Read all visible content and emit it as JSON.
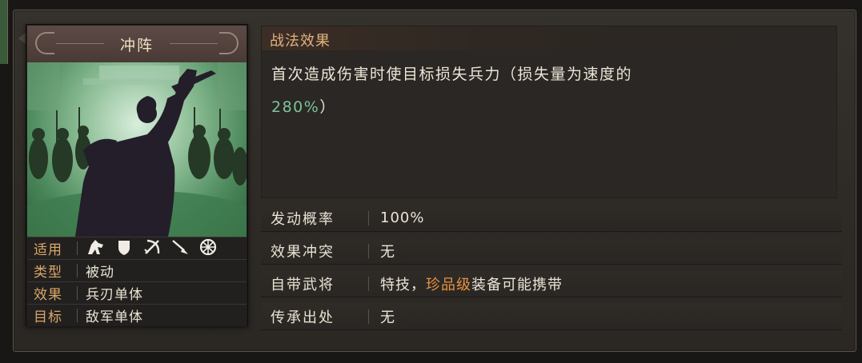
{
  "skill": {
    "name": "冲阵",
    "attributes": {
      "applicable": {
        "label": "适用",
        "icons": [
          "cavalry-icon",
          "shield-icon",
          "bow-icon",
          "spear-icon",
          "wheel-icon"
        ]
      },
      "type": {
        "label": "类型",
        "value": "被动"
      },
      "effect": {
        "label": "效果",
        "value": "兵刃单体"
      },
      "target": {
        "label": "目标",
        "value": "敌军单体"
      }
    }
  },
  "effect_panel": {
    "title": "战法效果",
    "text_main": "首次造成伤害时使目标损失兵力（损失量为速度的",
    "text_percent": "280%",
    "text_tail": "）"
  },
  "info": {
    "trigger_rate": {
      "label": "发动概率",
      "value": "100%"
    },
    "conflict": {
      "label": "效果冲突",
      "value": "无"
    },
    "own_general": {
      "label": "自带武将",
      "prefix": "特技，",
      "quality": "珍品级",
      "suffix": "装备可能携带"
    },
    "inheritance": {
      "label": "传承出处",
      "value": "无"
    }
  },
  "colors": {
    "accent_orange": "#e89240",
    "accent_green": "#7cc49a",
    "label_gold": "#d9a66a"
  }
}
